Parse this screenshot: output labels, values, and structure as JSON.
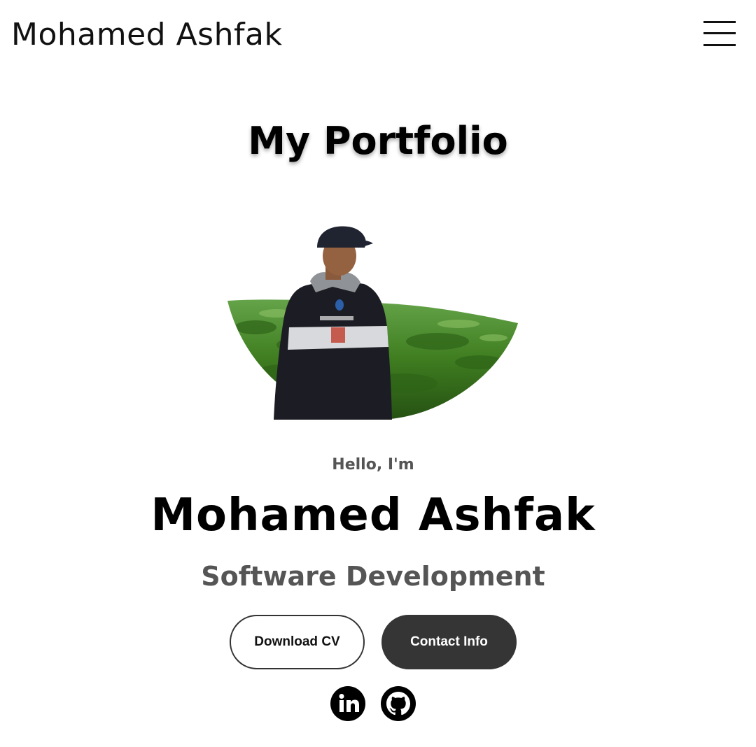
{
  "header": {
    "logo": "Mohamed Ashfak",
    "menu_icon": "hamburger-menu-icon"
  },
  "main": {
    "title": "My Portfolio",
    "hello": "Hello, I'm",
    "name": "Mohamed Ashfak",
    "role": "Software Development"
  },
  "buttons": {
    "download_cv": "Download CV",
    "contact_info": "Contact Info"
  },
  "social": {
    "linkedin_icon": "linkedin-icon",
    "github_icon": "github-icon"
  },
  "colors": {
    "primary_text": "#000000",
    "secondary_text": "#555555",
    "dark_button": "#353535",
    "background": "#ffffff"
  }
}
